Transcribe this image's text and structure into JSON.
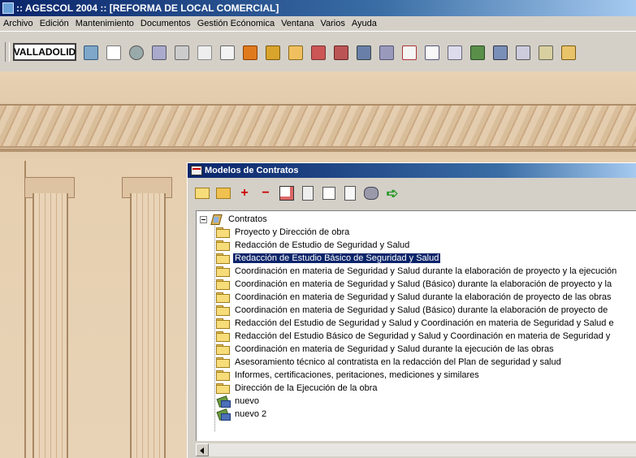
{
  "app": {
    "title": ":: AGESCOL 2004 :: [REFORMA DE LOCAL COMERCIAL]"
  },
  "menu": [
    "Archivo",
    "Edición",
    "Mantenimiento",
    "Documentos",
    "Gestión Ecónomica",
    "Ventana",
    "Varios",
    "Ayuda"
  ],
  "toolbar": {
    "city": "VALLADOLID"
  },
  "window": {
    "title": "Modelos de Contratos",
    "tree": {
      "root": "Contratos",
      "items": [
        {
          "label": "Proyecto y Dirección de obra",
          "icon": "folder-icon"
        },
        {
          "label": "Redacción de Estudio de Seguridad y Salud",
          "icon": "folder-icon"
        },
        {
          "label": "Redacción de Estudio Básico de Seguridad y Salud",
          "icon": "folder-icon",
          "selected": true
        },
        {
          "label": "Coordinación en materia de Seguridad y Salud durante la elaboración de proyecto y la ejecución",
          "icon": "folder-icon"
        },
        {
          "label": "Coordinación en materia de Seguridad y Salud (Básico) durante la elaboración de proyecto y la",
          "icon": "folder-icon"
        },
        {
          "label": "Coordinación en materia de Seguridad y Salud durante la elaboración de proyecto de las obras",
          "icon": "folder-icon"
        },
        {
          "label": "Coordinación en materia de Seguridad y Salud (Básico) durante la elaboración de proyecto de",
          "icon": "folder-icon"
        },
        {
          "label": "Redacción del Estudio de Seguridad y Salud y Coordinación en materia de Seguridad y Salud e",
          "icon": "folder-icon"
        },
        {
          "label": "Redacción del Estudio Básico de Seguridad y Salud y Coordinación en materia de Seguridad y",
          "icon": "folder-icon"
        },
        {
          "label": "Coordinación en materia de Seguridad y Salud durante la ejecución de las obras",
          "icon": "folder-icon"
        },
        {
          "label": "Asesoramiento técnico al contratista en la redacción del Plan de seguridad y salud",
          "icon": "folder-icon"
        },
        {
          "label": "Informes, certificaciones, peritaciones, mediciones y similares",
          "icon": "folder-icon"
        },
        {
          "label": "Dirección de la Ejecución de la obra",
          "icon": "folder-icon"
        },
        {
          "label": "nuevo",
          "icon": "document-icon"
        },
        {
          "label": "nuevo 2",
          "icon": "document-icon"
        }
      ]
    }
  }
}
